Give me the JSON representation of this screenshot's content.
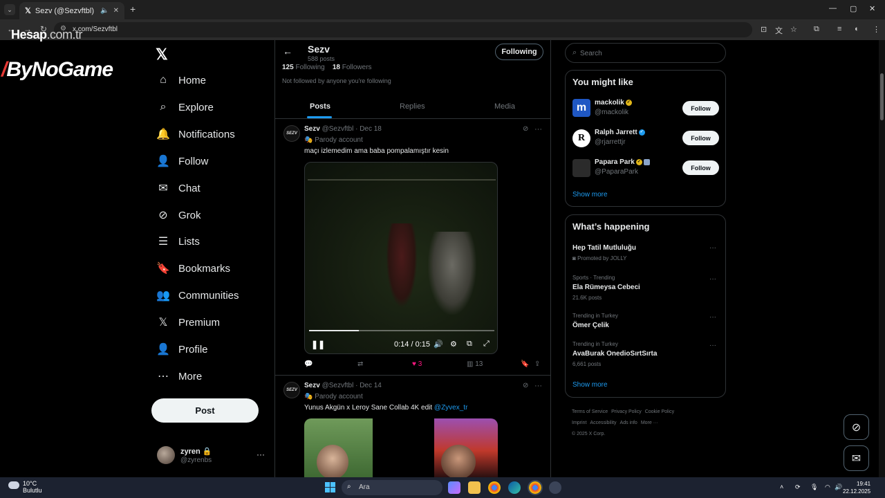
{
  "browser": {
    "tab_title": "Sezv (@Sezvftbl) / X",
    "url": "x.com/Sezvftbl"
  },
  "watermark": {
    "line1_main": "Hesap",
    "line1_domain": ".com.tr",
    "line2": "ByNoGame"
  },
  "nav": {
    "items": [
      {
        "label": "Home",
        "icon": "home-icon"
      },
      {
        "label": "Explore",
        "icon": "search-icon"
      },
      {
        "label": "Notifications",
        "icon": "bell-icon"
      },
      {
        "label": "Follow",
        "icon": "person-add-icon"
      },
      {
        "label": "Chat",
        "icon": "mail-icon"
      },
      {
        "label": "Grok",
        "icon": "grok-icon"
      },
      {
        "label": "Lists",
        "icon": "list-icon"
      },
      {
        "label": "Bookmarks",
        "icon": "bookmark-icon"
      },
      {
        "label": "Communities",
        "icon": "people-icon"
      },
      {
        "label": "Premium",
        "icon": "x-icon"
      },
      {
        "label": "Profile",
        "icon": "person-icon"
      },
      {
        "label": "More",
        "icon": "more-circle-icon"
      }
    ],
    "post_label": "Post",
    "user": {
      "name": "zyren",
      "handle": "@zyrenbs"
    }
  },
  "profile": {
    "name": "Sezv",
    "posts_count": "588 posts",
    "following_btn": "Following",
    "following_num": "125",
    "following_lbl": "Following",
    "followers_num": "18",
    "followers_lbl": "Followers",
    "not_followed": "Not followed by anyone you're following",
    "tabs": [
      "Posts",
      "Replies",
      "Media"
    ]
  },
  "tweets": [
    {
      "name": "Sezv",
      "meta": "@Sezvftbl · Dec 18",
      "parody": "Parody account",
      "text": "maçı izlemedim ama baba pompalamıştır kesin",
      "video": {
        "time": "0:14 / 0:15",
        "progress": 0.27
      },
      "actions": {
        "likes": "3",
        "views": "13"
      }
    },
    {
      "name": "Sezv",
      "meta": "@Sezvftbl · Dec 14",
      "parody": "Parody account",
      "text": "Yunus Akgün x Leroy Sane Collab 4K edit",
      "mention": "@Zyvex_tr"
    }
  ],
  "right": {
    "search_placeholder": "Search",
    "you_might_like": "You might like",
    "suggestions": [
      {
        "name": "mackolik",
        "handle": "@mackolik",
        "follow": "Follow"
      },
      {
        "name": "Ralph Jarrett",
        "handle": "@rjarrettjr",
        "follow": "Follow"
      },
      {
        "name": "Papara Park",
        "handle": "@PaparaPark",
        "follow": "Follow"
      }
    ],
    "show_more": "Show more",
    "whats_happening": "What’s happening",
    "trends": [
      {
        "context": "",
        "title": "Hep Tatil Mutluluğu",
        "count": "Promoted by JOLLY"
      },
      {
        "context": "Sports · Trending",
        "title": "Ela Rümeysa Cebeci",
        "count": "21.6K posts"
      },
      {
        "context": "Trending in Turkey",
        "title": "Ömer Çelik",
        "count": ""
      },
      {
        "context": "Trending in Turkey",
        "title": "AvaBurak OnedioSırtSırta",
        "count": "6,661 posts"
      }
    ],
    "footer": [
      "Terms of Service",
      "Privacy Policy",
      "Cookie Policy",
      "Imprint",
      "Accessibility",
      "Ads info",
      "More ···",
      "© 2025 X Corp."
    ]
  },
  "taskbar": {
    "temp": "10°C",
    "weather": "Bulutlu",
    "search": "Ara",
    "time": "19:41",
    "date": "22.12.2025"
  }
}
